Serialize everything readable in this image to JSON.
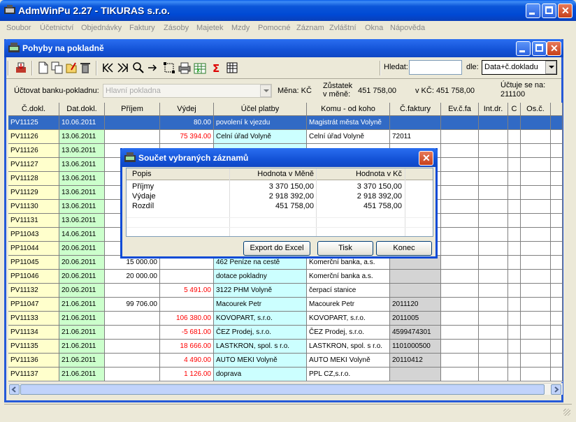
{
  "app": {
    "title": "AdmWinPu 2.27 - TIKURAS  s.r.o."
  },
  "menu": [
    "Soubor",
    "Účetnictví",
    "Objednávky",
    "Faktury",
    "Zásoby",
    "Majetek",
    "Mzdy",
    "Pomocné",
    "Záznam",
    "Zvláštní",
    "Okna",
    "Nápověda"
  ],
  "child": {
    "title": "Pohyby na pokladně"
  },
  "toolbar": {
    "search_label": "Hledat:",
    "search_value": "",
    "by_label": "dle:",
    "by_value": "Data+č.dokladu",
    "icons": [
      "print-icon",
      "new-document-icon",
      "copy-icon",
      "edit-icon",
      "delete-icon",
      "first-record-icon",
      "last-record-icon",
      "find-icon",
      "next-icon",
      "select-icon",
      "printer-icon",
      "excel-export-icon",
      "sum-icon",
      "calculator-icon"
    ]
  },
  "info": {
    "account_label": "Účtovat banku-pokladnu:",
    "account_value": "Hlavní pokladna",
    "currency_label": "Měna: KČ",
    "balance_label_1": "Zůstatek",
    "balance_label_2": "v měně:",
    "balance_value": "451 758,00",
    "balance_czk_label": "v KČ:",
    "balance_czk_value": "451 758,00",
    "posts_label_1": "Účtuje se na:",
    "posts_value": "211100"
  },
  "table": {
    "columns": [
      "Č.dokl.",
      "Dat.dokl.",
      "Příjem",
      "Výdej",
      "Účel platby",
      "Komu - od koho",
      "Č.faktury",
      "Ev.č.fa",
      "Int.dr.",
      "C",
      "Os.č."
    ],
    "rows": [
      [
        "PV11125",
        "10.06.2011",
        "",
        "80.00",
        "povolení k vjezdu",
        "Magistrát města Volyně",
        "",
        "",
        "",
        "",
        ""
      ],
      [
        "PV11126",
        "13.06.2011",
        "",
        "75 394.00",
        "Celní úřad Volyně",
        "Celní úřad Volyně",
        "72011",
        "",
        "",
        "",
        ""
      ],
      [
        "PV11126",
        "13.06.2011",
        "",
        "",
        "",
        "",
        "",
        "",
        "",
        "",
        ""
      ],
      [
        "PV11127",
        "13.06.2011",
        "",
        "",
        "",
        "",
        "",
        "",
        "",
        "",
        ""
      ],
      [
        "PV11128",
        "13.06.2011",
        "",
        "",
        "",
        "",
        "",
        "",
        "",
        "",
        ""
      ],
      [
        "PV11129",
        "13.06.2011",
        "",
        "",
        "",
        "",
        "",
        "",
        "",
        "",
        ""
      ],
      [
        "PV11130",
        "13.06.2011",
        "",
        "",
        "",
        "",
        "",
        "",
        "",
        "",
        ""
      ],
      [
        "PV11131",
        "13.06.2011",
        "",
        "",
        "",
        "",
        "",
        "",
        "",
        "",
        ""
      ],
      [
        "PP11043",
        "14.06.2011",
        "",
        "",
        "",
        "",
        "",
        "",
        "",
        "",
        ""
      ],
      [
        "PP11044",
        "20.06.2011",
        "",
        "",
        "",
        "",
        "",
        "",
        "",
        "",
        ""
      ],
      [
        "PP11045",
        "20.06.2011",
        "15 000.00",
        "",
        "462 Peníze na cestě",
        "Komerční banka, a.s.",
        "",
        "",
        "",
        "",
        ""
      ],
      [
        "PP11046",
        "20.06.2011",
        "20 000.00",
        "",
        "dotace pokladny",
        "Komerční banka a.s.",
        "",
        "",
        "",
        "",
        ""
      ],
      [
        "PV11132",
        "20.06.2011",
        "",
        "5 491.00",
        "3122 PHM Volyně",
        "čerpací stanice",
        "",
        "",
        "",
        "",
        ""
      ],
      [
        "PP11047",
        "21.06.2011",
        "99 706.00",
        "",
        "Macourek Petr",
        "Macourek Petr",
        "2011120",
        "",
        "",
        "",
        ""
      ],
      [
        "PV11133",
        "21.06.2011",
        "",
        "106 380.00",
        "KOVOPART, s.r.o.",
        "KOVOPART, s.r.o.",
        "2011005",
        "",
        "",
        "",
        ""
      ],
      [
        "PV11134",
        "21.06.2011",
        "",
        "-5 681.00",
        "ČEZ Prodej, s.r.o.",
        "ČEZ Prodej, s.r.o.",
        "4599474301",
        "",
        "",
        "",
        ""
      ],
      [
        "PV11135",
        "21.06.2011",
        "",
        "18 666.00",
        "LASTKRON, spol. s r.o.",
        "LASTKRON, spol. s r.o.",
        "1101000500",
        "",
        "",
        "",
        ""
      ],
      [
        "PV11136",
        "21.06.2011",
        "",
        "4 490.00",
        "AUTO MEKI Volyně",
        "AUTO MEKI Volyně",
        "20110412",
        "",
        "",
        "",
        ""
      ],
      [
        "PV11137",
        "21.06.2011",
        "",
        "1 126.00",
        "doprava",
        "PPL CZ,s.r.o.",
        "",
        "",
        "",
        "",
        ""
      ]
    ]
  },
  "dialog": {
    "title": "Součet vybraných záznamů",
    "columns": [
      "Popis",
      "Hodnota v Měně",
      "Hodnota v Kč"
    ],
    "rows": [
      [
        "Příjmy",
        "3 370 150,00",
        "3 370 150,00"
      ],
      [
        "Výdaje",
        "2 918 392,00",
        "2 918 392,00"
      ],
      [
        "Rozdíl",
        "451 758,00",
        "451 758,00"
      ]
    ],
    "buttons": {
      "export": "Export do Excel",
      "print": "Tisk",
      "close": "Konec"
    }
  },
  "colors": {
    "selected_row": "#316ac5",
    "doc_col": "#ffffcc",
    "date_col": "#ccffcc",
    "purpose_col": "#ccffff",
    "expense_text": "#ff0000",
    "invoice_col": "#d4d4d4"
  }
}
